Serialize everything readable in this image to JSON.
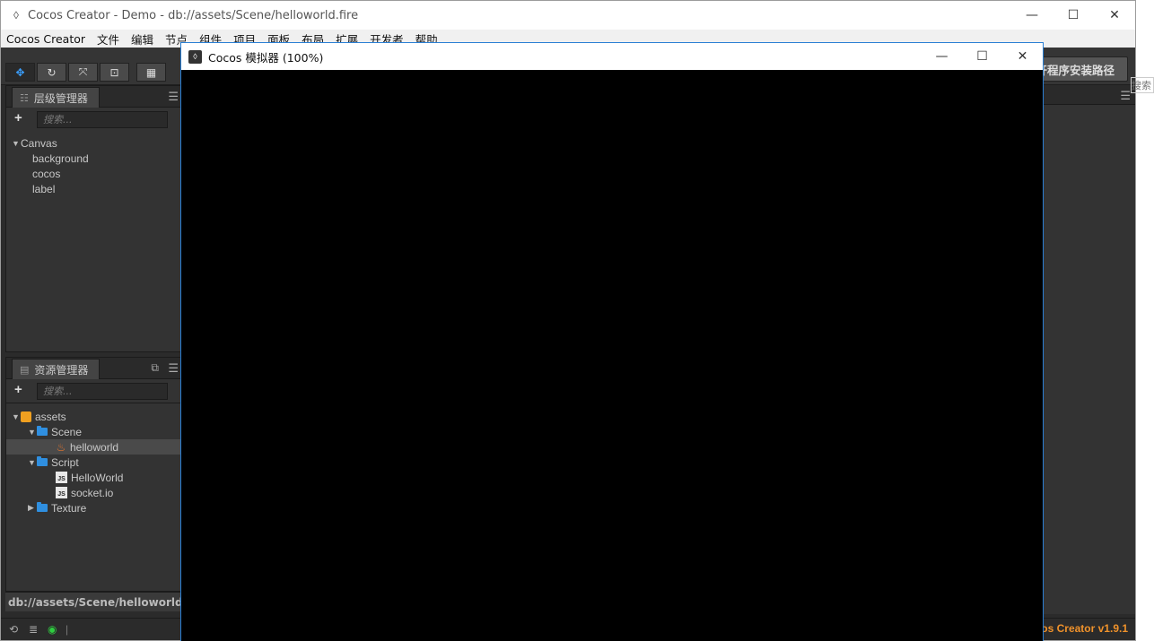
{
  "main_window": {
    "title": "Cocos Creator - Demo - db://assets/Scene/helloworld.fire",
    "controls": {
      "minimize": "—",
      "maximize": "☐",
      "close": "✕"
    }
  },
  "menubar": [
    "Cocos Creator",
    "文件",
    "编辑",
    "节点",
    "组件",
    "项目",
    "面板",
    "布局",
    "扩展",
    "开发者",
    "帮助"
  ],
  "toolbar": {
    "buttons": [
      "move-tool",
      "rotate-tool",
      "scale-tool",
      "rect-tool",
      "gizmo-toggle"
    ],
    "wx_button_label": "开程序安装路径"
  },
  "hierarchy": {
    "tab_label": "层级管理器",
    "search_placeholder": "搜索...",
    "tree": [
      {
        "label": "Canvas",
        "expanded": true
      },
      {
        "label": "background"
      },
      {
        "label": "cocos"
      },
      {
        "label": "label"
      }
    ]
  },
  "assets": {
    "tab_label": "资源管理器",
    "search_placeholder": "搜索...",
    "tree": {
      "root": "assets",
      "scene_folder": "Scene",
      "scene_file": "helloworld",
      "script_folder": "Script",
      "script_1": "HelloWorld",
      "script_2": "socket.io",
      "texture_folder": "Texture"
    }
  },
  "status": {
    "path": "db://assets/Scene/helloworld.fire",
    "version": "os Creator v1.9.1"
  },
  "browser": {
    "search_hint": "搜索"
  },
  "simulator": {
    "title": "Cocos 模拟器 (100%)",
    "controls": {
      "minimize": "—",
      "maximize": "☐",
      "close": "✕"
    }
  }
}
